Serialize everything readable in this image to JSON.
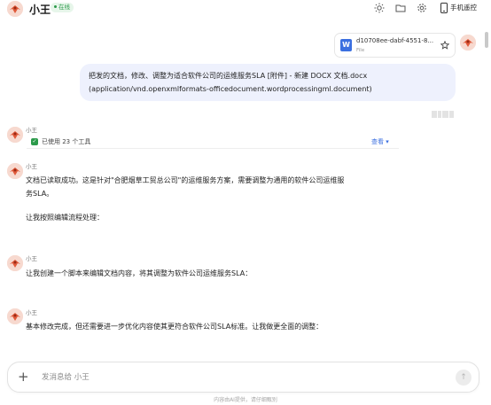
{
  "header": {
    "title": "小王",
    "status": "在线",
    "phone_label": "手机遥控"
  },
  "file_card": {
    "icon_letter": "W",
    "name": "d10708ee-dabf-4551-8...",
    "type": "File"
  },
  "user_message": {
    "text": "把发的文档，修改、调整为适合软件公司的运维服务SLA [附件] - 新建 DOCX 文档.docx (application/vnd.openxmlformats-officedocument.wordprocessingml.document)"
  },
  "messages": [
    {
      "sender": "小王"
    },
    {
      "sender": "小王",
      "lines": [
        "文档已读取成功。这是针对\"合肥烟草工贸总公司\"的运维服务方案，需要调整为通用的软件公司运维服",
        "务SLA。",
        "让我按照编辑流程处理："
      ]
    },
    {
      "sender": "小王",
      "lines": [
        "让我创建一个脚本来编辑文档内容，将其调整为软件公司运维服务SLA："
      ]
    },
    {
      "sender": "小王",
      "lines": [
        "基本修改完成，但还需要进一步优化内容使其更符合软件公司SLA标准。让我做更全面的调整："
      ]
    }
  ],
  "tools": {
    "label": "已使用 23 个工具",
    "view_label": "查看",
    "chevron": "▾"
  },
  "input": {
    "placeholder": "发消息给 小王"
  },
  "footer": "内容由AI提供，请仔细甄别",
  "colors": {
    "accent": "#3b6fe0",
    "status_green": "#2c9a4b",
    "user_bubble": "#eef1fd"
  },
  "icons": [
    "sun-icon",
    "folder-icon",
    "gear-icon",
    "phone-icon",
    "word-file-icon",
    "star-icon",
    "plus-icon",
    "send-arrow-icon",
    "check-icon"
  ]
}
